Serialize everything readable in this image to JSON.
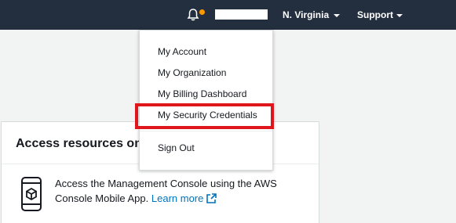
{
  "topbar": {
    "region_label": "N. Virginia",
    "support_label": "Support",
    "icons": {
      "notifications": "bell-icon",
      "region_caret": "chevron-down-icon",
      "support_caret": "chevron-down-icon"
    },
    "colors": {
      "background": "#232f3e",
      "notification_dot": "#ff9900"
    }
  },
  "account_menu": {
    "items": [
      {
        "label": "My Account"
      },
      {
        "label": "My Organization"
      },
      {
        "label": "My Billing Dashboard"
      },
      {
        "label": "My Security Credentials"
      },
      {
        "label": "Sign Out"
      }
    ],
    "highlight_color": "#e0161d"
  },
  "card": {
    "title": "Access resources on t",
    "description": "Access the Management Console using the AWS Console Mobile App.",
    "link_label": "Learn more",
    "link_color": "#0073bb"
  }
}
